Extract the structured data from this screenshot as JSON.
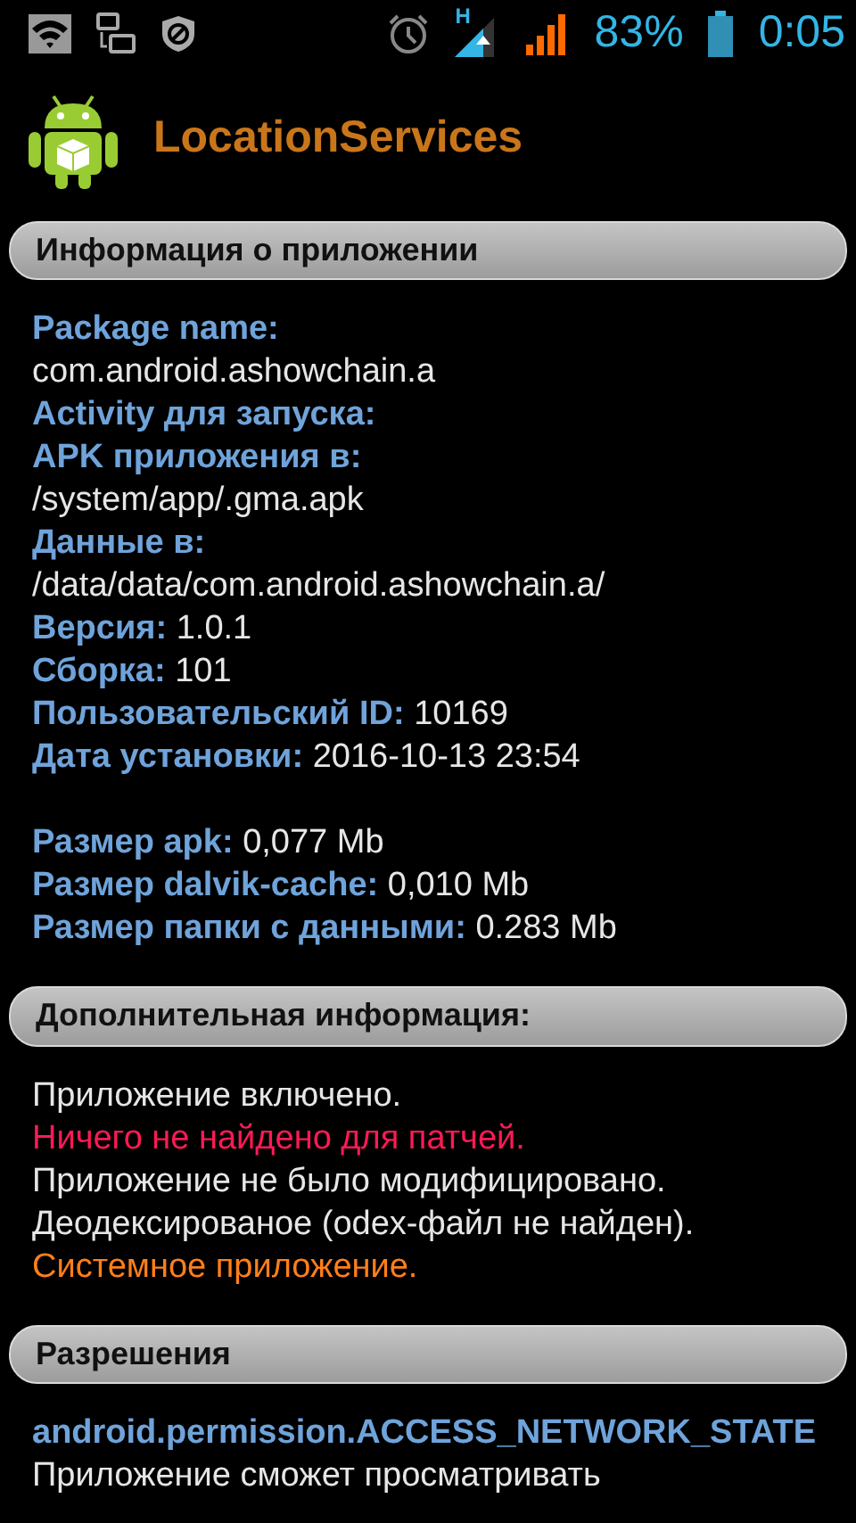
{
  "status_bar": {
    "network_type": "H",
    "battery": "83%",
    "time": "0:05"
  },
  "app": {
    "name": "LocationServices"
  },
  "info": {
    "title": "Информация о приложении",
    "groups": [
      [
        {
          "label": "Package name:"
        },
        {
          "value": "com.android.ashowchain.a"
        },
        {
          "label": "Activity для запуска:"
        },
        {
          "label": "APK приложения в:"
        },
        {
          "value": "/system/app/.gma.apk"
        },
        {
          "label": "Данные в:"
        },
        {
          "value": "/data/data/com.android.ashowchain.a/"
        },
        {
          "label": "Версия:",
          "value": "1.0.1"
        },
        {
          "label": "Сборка:",
          "value": "101"
        },
        {
          "label": "Пользовательский ID:",
          "value": "10169"
        },
        {
          "label": "Дата установки:",
          "value": "2016-10-13 23:54"
        }
      ],
      [
        {
          "label": "Размер apk:",
          "value": "0,077 Mb"
        },
        {
          "label": "Размер dalvik-cache:",
          "value": "0,010 Mb"
        },
        {
          "label": "Размер папки с данными:",
          "value": "0.283 Mb"
        }
      ]
    ]
  },
  "extra": {
    "title": "Дополнительная информация:",
    "lines": [
      {
        "text": "Приложение включено.",
        "color": "#e6e6e6"
      },
      {
        "text": "Ничего не найдено для патчей.",
        "color": "#ff1a55"
      },
      {
        "text": "Приложение не было модифицировано.",
        "color": "#e6e6e6"
      },
      {
        "text": "Деодексированое (odex-файл не найден).",
        "color": "#e6e6e6"
      },
      {
        "text": "Системное приложение.",
        "color": "#ff7f1a"
      }
    ]
  },
  "permissions": {
    "title": "Разрешения",
    "items": [
      {
        "name": "android.permission.ACCESS_NETWORK_STATE",
        "description": "Приложение сможет просматривать"
      }
    ]
  }
}
